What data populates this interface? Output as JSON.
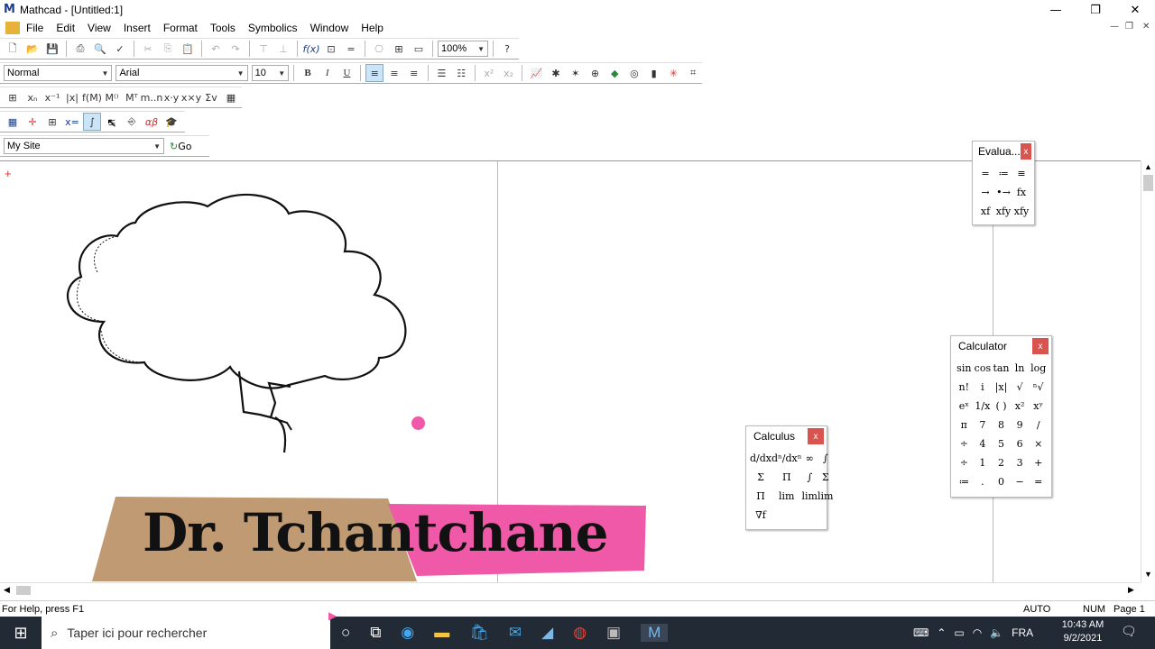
{
  "window": {
    "title": "Mathcad - [Untitled:1]",
    "app_icon": "M"
  },
  "menu": [
    "File",
    "Edit",
    "View",
    "Insert",
    "Format",
    "Tools",
    "Symbolics",
    "Window",
    "Help"
  ],
  "toolbar": {
    "zoom": "100%"
  },
  "format_bar": {
    "style": "Normal",
    "font": "Arial",
    "size": "10",
    "bold": "B",
    "italic": "I",
    "underline": "U"
  },
  "resources": {
    "site": "My Site",
    "go": "Go"
  },
  "palettes": {
    "evaluation": {
      "title": "Evalua...",
      "close": "x",
      "items": [
        "=",
        "≔",
        "≡",
        "→",
        "•→",
        "fx",
        "xf",
        "xfy",
        "xfy"
      ]
    },
    "calculator": {
      "title": "Calculator",
      "close": "x",
      "items": [
        "sin",
        "cos",
        "tan",
        "ln",
        "log",
        "n!",
        "i",
        "|x|",
        "√",
        "ⁿ√",
        "eˣ",
        "1/x",
        "( )",
        "x²",
        "xʸ",
        "π",
        "7",
        "8",
        "9",
        "/",
        "÷",
        "4",
        "5",
        "6",
        "×",
        "÷",
        "1",
        "2",
        "3",
        "+",
        "≔",
        ".",
        "0",
        "−",
        "="
      ]
    },
    "calculus": {
      "title": "Calculus",
      "close": "x",
      "items": [
        "d/dx",
        "dⁿ/dxⁿ",
        "∞",
        "∫",
        "Σ",
        "Π",
        "∫",
        "Σ",
        "Π",
        "lim",
        "lim",
        "lim",
        "∇f"
      ]
    }
  },
  "banner": {
    "text": "Dr. Tchantchane",
    "tan_color": "#c09a72",
    "pink_color": "#f059a8"
  },
  "status": {
    "help": "For Help, press F1",
    "mode": "AUTO",
    "num": "NUM",
    "page": "Page 1"
  },
  "taskbar": {
    "search_placeholder": "Taper ici pour rechercher",
    "lang": "FRA",
    "time": "10:43 AM",
    "date": "9/2/2021"
  }
}
